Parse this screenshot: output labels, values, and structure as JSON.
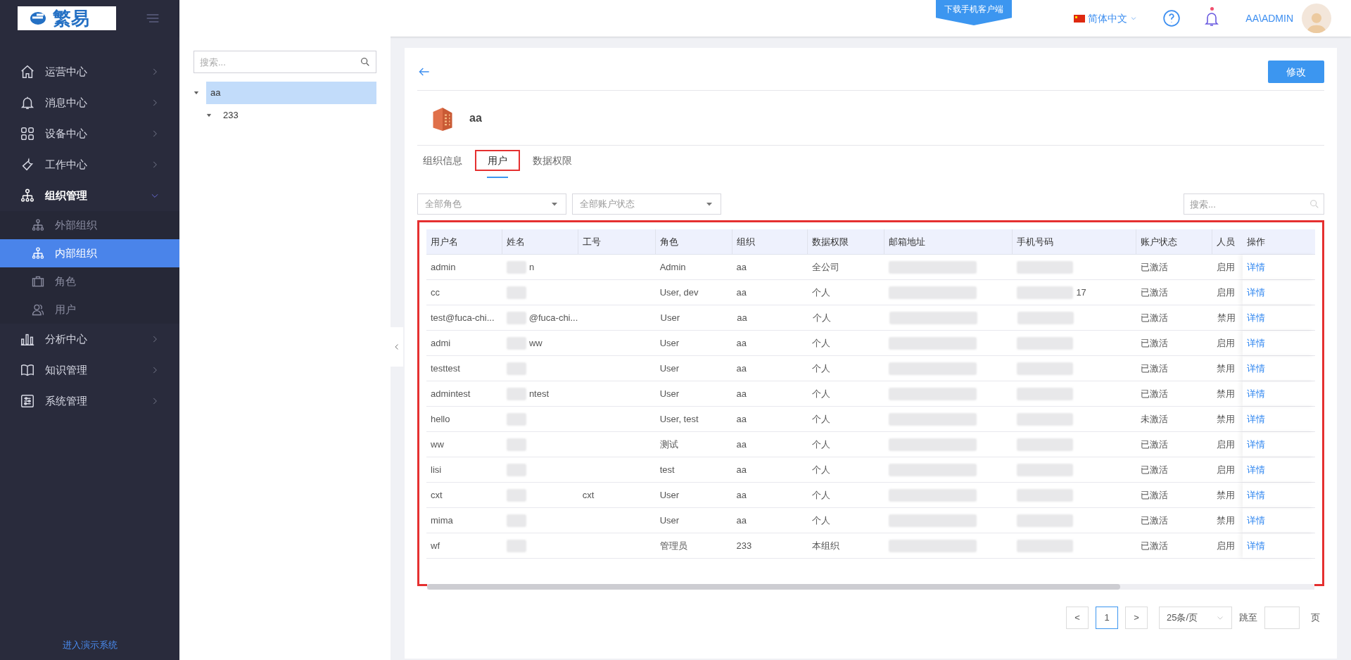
{
  "brand": {
    "logo_text": "繁易"
  },
  "topbar": {
    "download_ribbon": "下载手机客户端",
    "language": "简体中文",
    "user": "AA\\ADMIN",
    "notification_dot": true
  },
  "sidebar": {
    "items": [
      {
        "label": "运营中心",
        "expanded": false,
        "selected": false
      },
      {
        "label": "消息中心",
        "expanded": false,
        "selected": false
      },
      {
        "label": "设备中心",
        "expanded": false,
        "selected": false
      },
      {
        "label": "工作中心",
        "expanded": false,
        "selected": false
      },
      {
        "label": "组织管理",
        "expanded": true,
        "selected": false,
        "children": [
          {
            "label": "外部组织",
            "selected": false
          },
          {
            "label": "内部组织",
            "selected": true
          },
          {
            "label": "角色",
            "selected": false
          },
          {
            "label": "用户",
            "selected": false
          }
        ]
      },
      {
        "label": "分析中心",
        "expanded": false,
        "selected": false
      },
      {
        "label": "知识管理",
        "expanded": false,
        "selected": false
      },
      {
        "label": "系统管理",
        "expanded": false,
        "selected": false
      }
    ],
    "footer_link": "进入演示系统"
  },
  "tree": {
    "search_placeholder": "搜索...",
    "nodes": [
      {
        "label": "aa",
        "selected": true,
        "expanded": true,
        "children": [
          {
            "label": "233",
            "selected": false,
            "expanded": true
          }
        ]
      }
    ]
  },
  "detail": {
    "edit_button": "修改",
    "org_name": "aa",
    "tabs": [
      {
        "label": "组织信息",
        "selected": false,
        "highlighted": false
      },
      {
        "label": "用户",
        "selected": true,
        "highlighted": true
      },
      {
        "label": "数据权限",
        "selected": false,
        "highlighted": false
      }
    ],
    "filters": [
      {
        "placeholder": "全部角色"
      },
      {
        "placeholder": "全部账户状态"
      }
    ],
    "search_placeholder": "搜索...",
    "table": {
      "highlighted": true,
      "columns": [
        "用户名",
        "姓名",
        "工号",
        "角色",
        "组织",
        "数据权限",
        "邮箱地址",
        "手机号码",
        "账户状态",
        "人员",
        "操作"
      ],
      "rows": [
        {
          "username": "admin",
          "name_visible": "n",
          "role": "Admin",
          "org": "aa",
          "scope": "全公司",
          "account_status": "已激活",
          "person_status": "启用",
          "action": "详情"
        },
        {
          "username": "cc",
          "role": "User, dev",
          "org": "aa",
          "scope": "个人",
          "phone_visible": "17",
          "account_status": "已激活",
          "person_status": "启用",
          "action": "详情"
        },
        {
          "username": "test@fuca-chi...",
          "name_visible": "@fuca-chi...",
          "role": "User",
          "org": "aa",
          "scope": "个人",
          "account_status": "已激活",
          "person_status": "禁用",
          "action": "详情"
        },
        {
          "username": "admi",
          "name_visible": "ww",
          "role": "User",
          "org": "aa",
          "scope": "个人",
          "account_status": "已激活",
          "person_status": "启用",
          "action": "详情"
        },
        {
          "username": "testtest",
          "role": "User",
          "org": "aa",
          "scope": "个人",
          "account_status": "已激活",
          "person_status": "禁用",
          "action": "详情"
        },
        {
          "username": "admintest",
          "name_visible": "ntest",
          "role": "User",
          "org": "aa",
          "scope": "个人",
          "account_status": "已激活",
          "person_status": "禁用",
          "action": "详情"
        },
        {
          "username": "hello",
          "role": "User, test",
          "org": "aa",
          "scope": "个人",
          "account_status": "未激活",
          "person_status": "禁用",
          "action": "详情"
        },
        {
          "username": "ww",
          "role": "测试",
          "org": "aa",
          "scope": "个人",
          "account_status": "已激活",
          "person_status": "启用",
          "action": "详情"
        },
        {
          "username": "lisi",
          "role": "test",
          "org": "aa",
          "scope": "个人",
          "account_status": "已激活",
          "person_status": "启用",
          "action": "详情"
        },
        {
          "username": "cxt",
          "employee_id": "cxt",
          "role": "User",
          "org": "aa",
          "scope": "个人",
          "account_status": "已激活",
          "person_status": "禁用",
          "action": "详情"
        },
        {
          "username": "mima",
          "role": "User",
          "org": "aa",
          "scope": "个人",
          "account_status": "已激活",
          "person_status": "禁用",
          "action": "详情"
        },
        {
          "username": "wf",
          "role": "管理员",
          "org": "233",
          "scope": "本组织",
          "account_status": "已激活",
          "person_status": "启用",
          "action": "详情"
        }
      ]
    },
    "pagination": {
      "prev": "<",
      "pages": [
        {
          "label": "1",
          "selected": true
        }
      ],
      "next": ">",
      "page_size": "25条/页",
      "jump_label": "跳至",
      "page_suffix": "页"
    }
  }
}
